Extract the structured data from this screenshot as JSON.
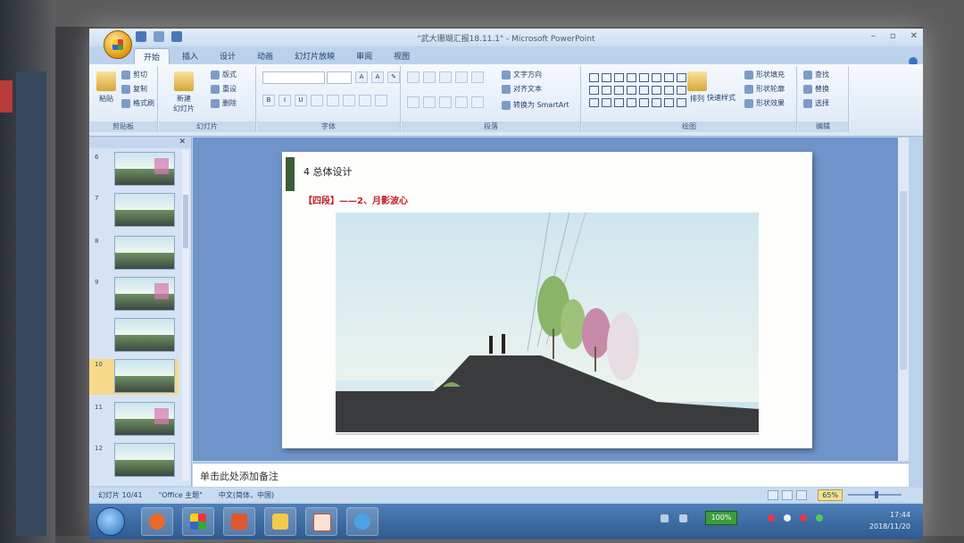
{
  "window": {
    "title": "\"武大珊瑚汇报18.11.1\" - Microsoft PowerPoint"
  },
  "ribbon": {
    "tabs": [
      "开始",
      "插入",
      "设计",
      "动画",
      "幻灯片放映",
      "审阅",
      "视图"
    ],
    "active_tab": "开始",
    "clipboard": {
      "label": "剪贴板",
      "paste": "粘贴",
      "cut": "剪切",
      "copy": "复制",
      "format_painter": "格式刷"
    },
    "slides": {
      "label": "幻灯片",
      "new_slide": "新建\n幻灯片",
      "layout": "版式",
      "reset": "重设",
      "delete": "删除"
    },
    "font": {
      "label": "字体",
      "bold": "B",
      "italic": "I",
      "underline": "U"
    },
    "paragraph": {
      "label": "段落",
      "text_direction": "文字方向",
      "align_text": "对齐文本",
      "smartart": "转换为 SmartArt"
    },
    "drawing": {
      "label": "绘图",
      "arrange": "排列",
      "quick_styles": "快速样式",
      "shape_fill": "形状填充",
      "shape_outline": "形状轮廓",
      "shape_effects": "形状效果"
    },
    "editing": {
      "label": "编辑",
      "find": "查找",
      "replace": "替换",
      "select": "选择"
    }
  },
  "slide_pane": {
    "numbers": [
      "6",
      "7",
      "8",
      "9",
      "10",
      "11",
      "12"
    ],
    "selected_number": "10"
  },
  "slide": {
    "heading": "4 总体设计",
    "subtitle": "【四段】——2、月影波心"
  },
  "notes_placeholder": "单击此处添加备注",
  "status": {
    "slide_indicator": "幻灯片 10/41",
    "theme": "\"Office 主题\"",
    "language": "中文(简体，中国)",
    "zoom": "65%"
  },
  "taskbar": {
    "battery": "100%",
    "time": "17:44",
    "date": "2018/11/20"
  },
  "colors": {
    "accent_red": "#c0202a",
    "slide_bar_green": "#3e5b3a",
    "ribbon_blue": "#dbe7f5"
  }
}
